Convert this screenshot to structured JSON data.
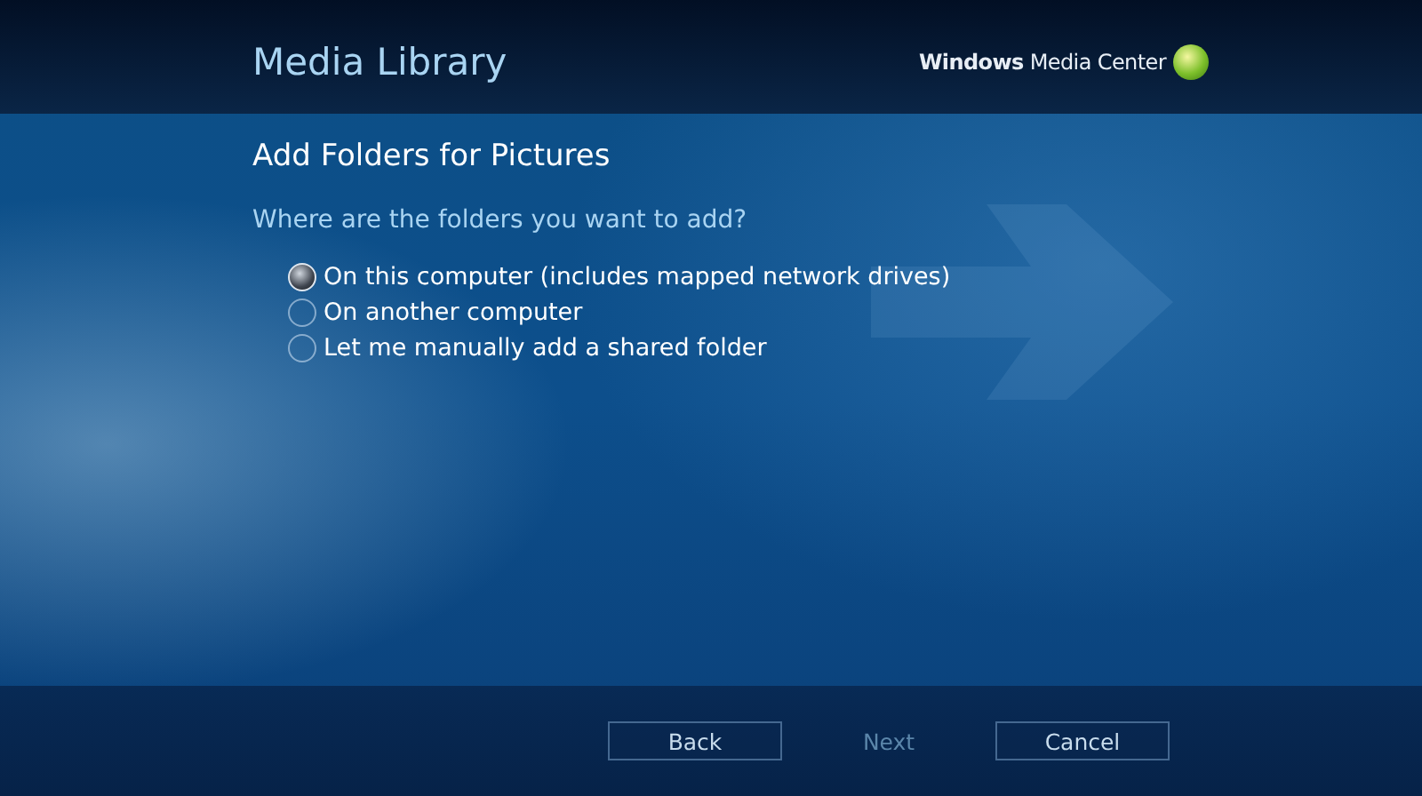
{
  "header": {
    "title": "Media Library",
    "brand": "**Windows** Media Center"
  },
  "page_title": "Add Folders for Pictures",
  "question": "Where are the folders you want to add?",
  "options": [
    {
      "label": "On this computer (includes mapped network drives)",
      "selected": true
    },
    {
      "label": "On another computer",
      "selected": false
    },
    {
      "label": "Let me manually add a shared folder",
      "selected": false
    }
  ],
  "buttons": [
    {
      "label": "Back",
      "disabled": false
    },
    {
      "label": "Next",
      "disabled": true
    },
    {
      "label": "Cancel",
      "disabled": false
    }
  ]
}
